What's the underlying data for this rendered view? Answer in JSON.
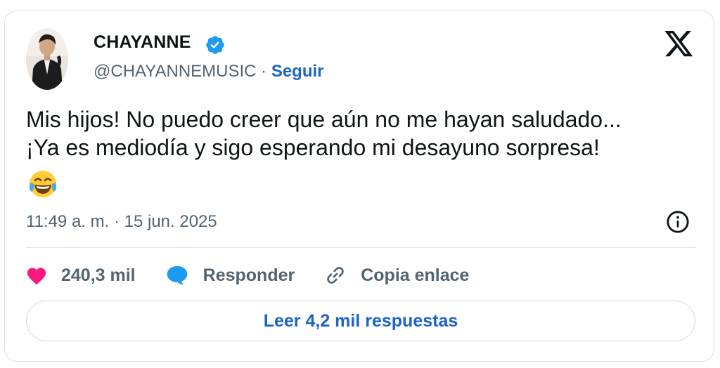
{
  "user": {
    "display_name": "CHAYANNE",
    "handle": "@CHAYANNEMUSIC",
    "separator": " · ",
    "follow_label": "Seguir"
  },
  "tweet": {
    "line1": "Mis hijos! No puedo creer que aún no me hayan saludado...",
    "line2": "¡Ya es mediodía y sigo esperando mi desayuno sorpresa!",
    "emoji": "face-with-tears-of-joy",
    "timestamp": "11:49 a. m. · 15 jun. 2025"
  },
  "actions": {
    "likes_count": "240,3 mil",
    "reply_label": "Responder",
    "copy_link_label": "Copia enlace"
  },
  "replies_button_label": "Leer 4,2 mil respuestas",
  "icons": {
    "verified": "verified-badge-icon",
    "platform": "x-logo-icon",
    "info": "info-icon",
    "like": "heart-icon",
    "reply": "speech-bubble-icon",
    "copy_link": "link-icon"
  },
  "colors": {
    "accent_blue": "#1d63c8",
    "verified_blue": "#1d9bf0",
    "heart_pink": "#f91880",
    "reply_bubble_blue": "#1d9bf0",
    "text_primary": "#0f1419",
    "text_secondary": "#536471"
  }
}
